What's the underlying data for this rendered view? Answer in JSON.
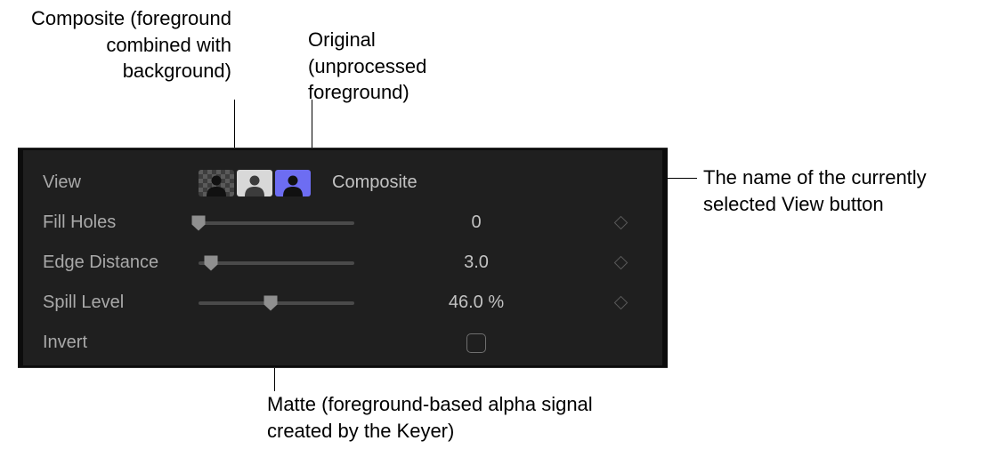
{
  "callouts": {
    "composite": "Composite (foreground combined with background)",
    "original": "Original (unprocessed foreground)",
    "matte": "Matte (foreground-based alpha signal created by the Keyer)",
    "viewname": "The name of the currently selected View button"
  },
  "panel": {
    "view_label": "View",
    "selected_view_name": "Composite",
    "fill_holes": {
      "label": "Fill Holes",
      "value": "0",
      "slider_pct": 0
    },
    "edge_distance": {
      "label": "Edge Distance",
      "value": "3.0",
      "slider_pct": 8
    },
    "spill_level": {
      "label": "Spill Level",
      "value": "46.0 %",
      "slider_pct": 46
    },
    "invert": {
      "label": "Invert",
      "checked": false
    }
  }
}
